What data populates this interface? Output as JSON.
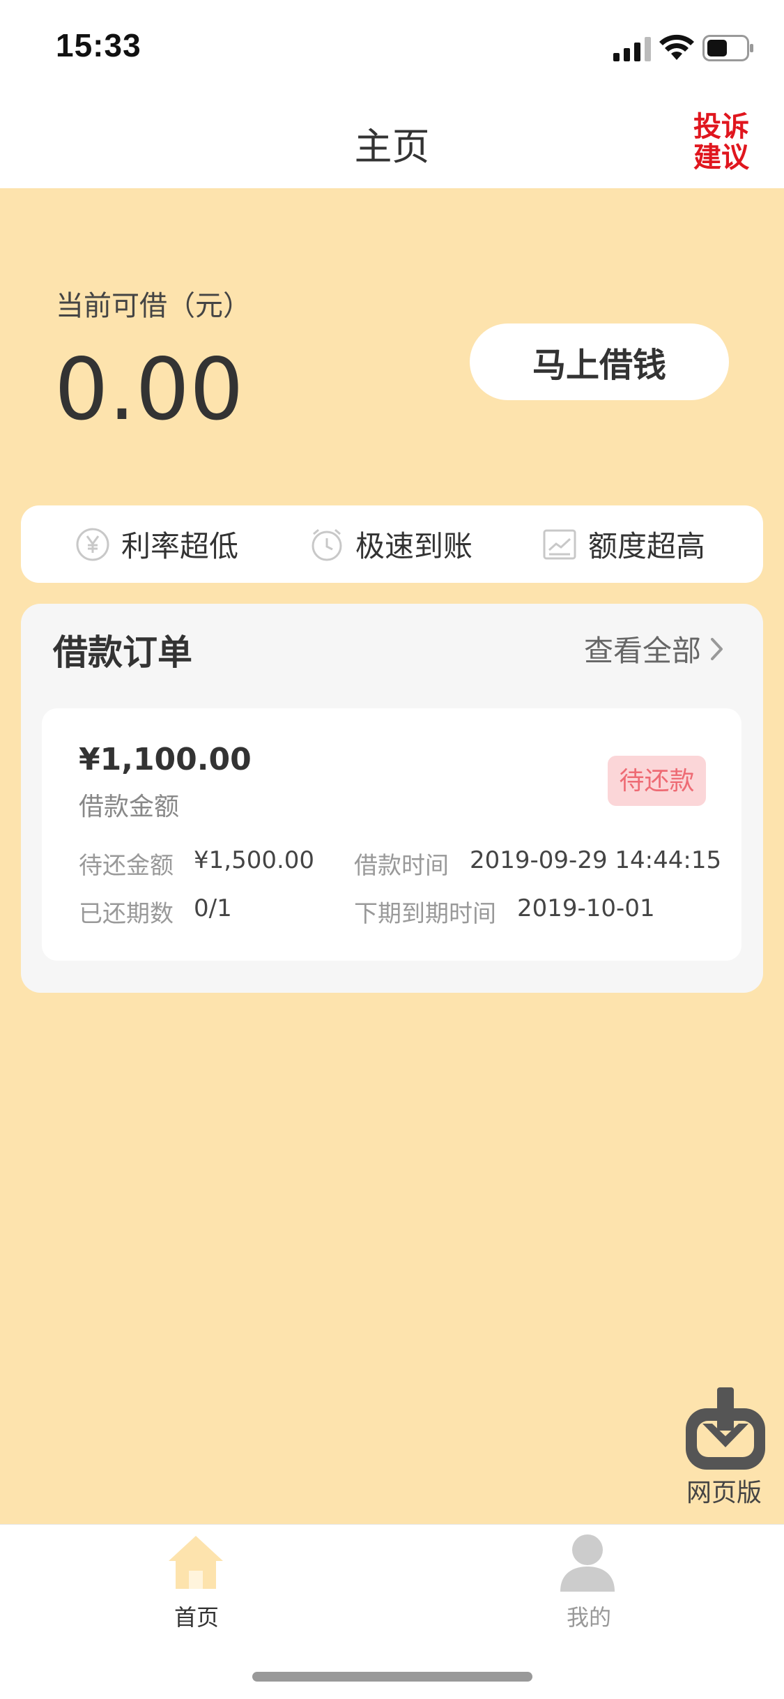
{
  "status_bar": {
    "time": "15:33"
  },
  "nav": {
    "title": "主页",
    "complaint_line1": "投诉",
    "complaint_line2": "建议"
  },
  "main": {
    "available_label": "当前可借（元）",
    "available_amount": "0.00",
    "borrow_button": "马上借钱"
  },
  "features": [
    {
      "icon": "yen-circle-icon",
      "label": "利率超低"
    },
    {
      "icon": "clock-icon",
      "label": "极速到账"
    },
    {
      "icon": "chart-icon",
      "label": "额度超高"
    }
  ],
  "orders": {
    "title": "借款订单",
    "view_all": "查看全部",
    "card": {
      "amount": "¥1,100.00",
      "amount_label": "借款金额",
      "status": "待还款",
      "pending_label": "待还金额",
      "pending_value": "¥1,500.00",
      "loan_time_label": "借款时间",
      "loan_time_value": "2019-09-29 14:44:15",
      "periods_label": "已还期数",
      "periods_value": "0/1",
      "next_due_label": "下期到期时间",
      "next_due_value": "2019-10-01"
    }
  },
  "download": {
    "icon": "download-icon",
    "label": "网页版"
  },
  "tabbar": {
    "home_label": "首页",
    "mine_label": "我的",
    "active_color": "#fde3ad",
    "inactive_color": "#cccccc"
  },
  "colors": {
    "background": "#fde3ad",
    "complaint": "#e0161e",
    "badge_bg": "#fbd6d8",
    "badge_text": "#ee6b74"
  }
}
